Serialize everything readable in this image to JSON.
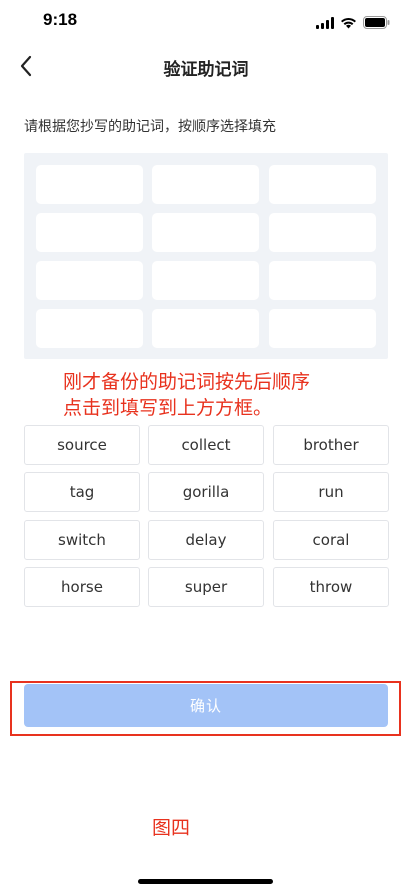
{
  "status": {
    "time": "9:18",
    "icons": [
      "signal-icon",
      "wifi-icon",
      "battery-icon"
    ]
  },
  "header": {
    "title": "验证助记词",
    "back_icon": "chevron-left-icon"
  },
  "instruction": "请根据您抄写的助记词，按顺序选择填充",
  "slots": [
    "",
    "",
    "",
    "",
    "",
    "",
    "",
    "",
    "",
    "",
    "",
    ""
  ],
  "annotation": {
    "line1": "刚才备份的助记词按先后顺序",
    "line2": "点击到填写到上方方框。"
  },
  "words": [
    "source",
    "collect",
    "brother",
    "tag",
    "gorilla",
    "run",
    "switch",
    "delay",
    "coral",
    "horse",
    "super",
    "throw"
  ],
  "confirm_label": "确认",
  "figure_label": "图四",
  "colors": {
    "accent_disabled": "#a3c3f7",
    "annotation_red": "#e8321e",
    "panel_bg": "#f0f3f7"
  }
}
